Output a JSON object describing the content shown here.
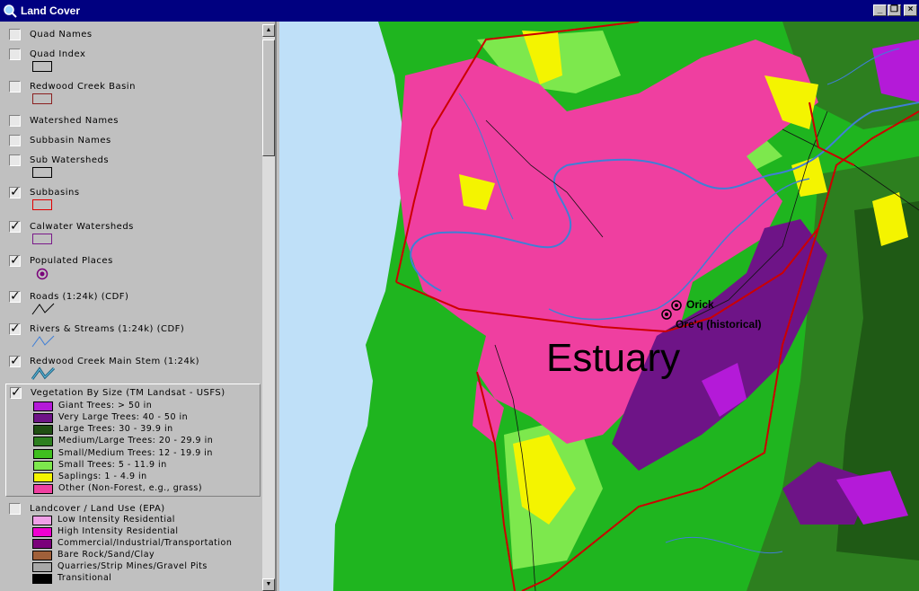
{
  "window": {
    "title": "Land Cover"
  },
  "colors": {
    "titlebar": "#000080",
    "ocean": "#bfe0f8",
    "coastal_green": "#1fb51f",
    "grass_pink": "#ef3fa0",
    "sapling_yellow": "#f4f400",
    "small_trees": "#7de84d",
    "large_trees": "#2d7f1f",
    "very_large": "#6e1487",
    "giant": "#b41ad8",
    "basin_outline": "#cc0000",
    "river": "#3f7fd6"
  },
  "toc": {
    "layers": [
      {
        "name": "Quad Names",
        "checked": false
      },
      {
        "name": "Quad Index",
        "checked": false
      },
      {
        "name": "Redwood Creek Basin",
        "checked": false
      },
      {
        "name": "Watershed Names",
        "checked": false
      },
      {
        "name": "Subbasin Names",
        "checked": false
      },
      {
        "name": "Sub Watersheds",
        "checked": false
      },
      {
        "name": "Subbasins",
        "checked": true
      },
      {
        "name": "Calwater Watersheds",
        "checked": true
      },
      {
        "name": "Populated Places",
        "checked": true
      },
      {
        "name": "Roads (1:24k) (CDF)",
        "checked": true
      },
      {
        "name": "Rivers & Streams (1:24k) (CDF)",
        "checked": true
      },
      {
        "name": "Redwood Creek Main Stem (1:24k)",
        "checked": true
      },
      {
        "name": "Vegetation By Size (TM Landsat - USFS)",
        "checked": true
      },
      {
        "name": "Landcover / Land Use (EPA)",
        "checked": false
      }
    ],
    "vegetation_legend": [
      {
        "label": "Giant Trees: > 50 in",
        "color": "#b41ad8"
      },
      {
        "label": "Very Large Trees: 40 - 50 in",
        "color": "#6e1487"
      },
      {
        "label": "Large Trees: 30 - 39.9 in",
        "color": "#1f4f12"
      },
      {
        "label": "Medium/Large Trees: 20 - 29.9 in",
        "color": "#2d7f1f"
      },
      {
        "label": "Small/Medium Trees: 12 - 19.9 in",
        "color": "#3fbf1f"
      },
      {
        "label": "Small Trees: 5 - 11.9 in",
        "color": "#7de84d"
      },
      {
        "label": "Saplings: 1 - 4.9 in",
        "color": "#f4f400"
      },
      {
        "label": "Other (Non-Forest, e.g., grass)",
        "color": "#ef3fa0"
      }
    ],
    "landcover_legend": [
      {
        "label": "Low Intensity Residential",
        "color": "#f0a0e8"
      },
      {
        "label": "High Intensity Residential",
        "color": "#f000d0"
      },
      {
        "label": "Commercial/Industrial/Transportation",
        "color": "#7a007a"
      },
      {
        "label": "Bare Rock/Sand/Clay",
        "color": "#a0603a"
      },
      {
        "label": "Quarries/Strip Mines/Gravel Pits",
        "color": "#a8a8a8"
      },
      {
        "label": "Transitional",
        "color": "#000000"
      }
    ]
  },
  "map": {
    "places": [
      {
        "name": "Orick"
      },
      {
        "name": "Ore'q (historical)"
      }
    ],
    "area_label": "Estuary"
  }
}
